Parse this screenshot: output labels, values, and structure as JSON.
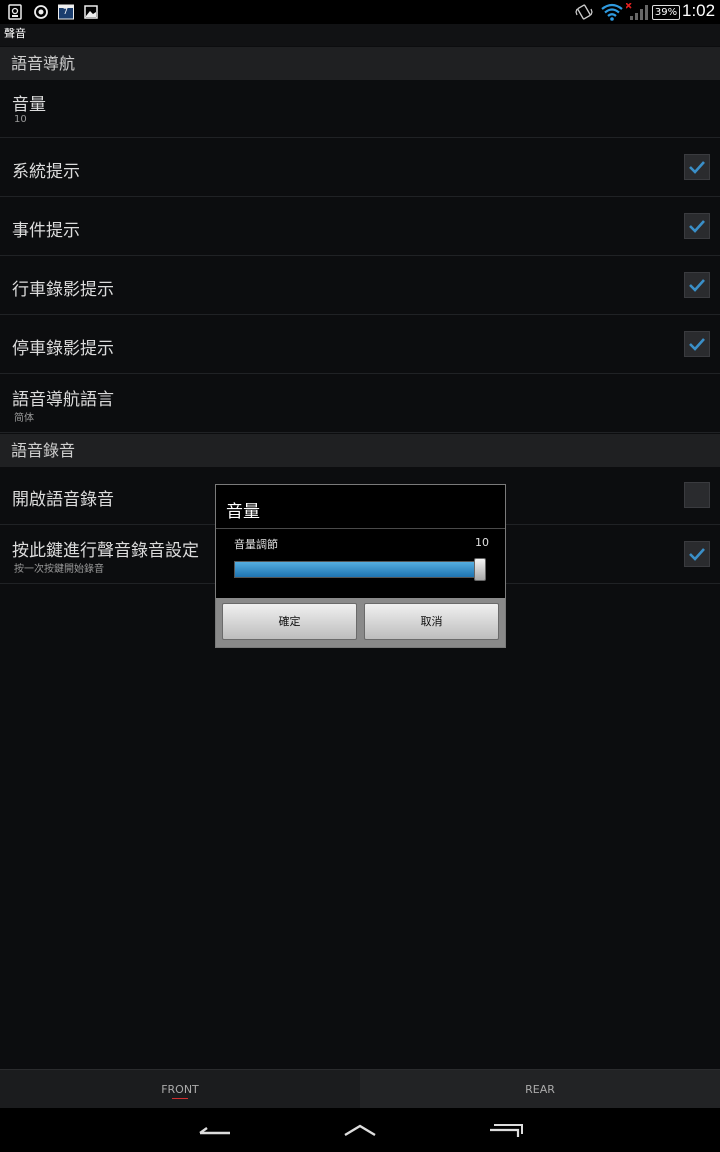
{
  "status_bar": {
    "icons_left": [
      "sim-card-icon",
      "sync-icon",
      "calendar-icon",
      "image-icon"
    ],
    "calendar_day": "7",
    "icons_right": [
      "vibrate-icon",
      "wifi-icon",
      "signal-icon"
    ],
    "battery": "39",
    "time": "1:02"
  },
  "screen_title": "聲音",
  "sections": [
    {
      "header": "語音導航",
      "rows": [
        {
          "title": "音量",
          "summary": "10",
          "checkbox": null
        },
        {
          "title": "系統提示",
          "checkbox": true
        },
        {
          "title": "事件提示",
          "checkbox": true
        },
        {
          "title": "行車錄影提示",
          "checkbox": true
        },
        {
          "title": "停車錄影提示",
          "checkbox": true
        },
        {
          "title": "語音導航語言",
          "summary": "简体",
          "checkbox": null
        }
      ]
    },
    {
      "header": "語音錄音",
      "rows": [
        {
          "title": "開啟語音錄音",
          "checkbox": false
        },
        {
          "title": "按此鍵進行聲音錄音設定",
          "summary": "按一次按鍵開始錄音",
          "checkbox": true
        }
      ]
    }
  ],
  "dialog": {
    "title": "音量",
    "slider_label": "音量調節",
    "slider_value": "10",
    "slider_level": 1.0,
    "ok_label": "確定",
    "cancel_label": "取消"
  },
  "tabs": [
    {
      "label": "FRONT",
      "selected": true
    },
    {
      "label": "REAR",
      "selected": false
    }
  ],
  "nav": [
    "back-icon",
    "home-icon",
    "recent-apps-icon"
  ],
  "colors": {
    "accent": "#2f8fd0",
    "check": "#3a8fc8",
    "tab_indicator": "#d03030"
  }
}
